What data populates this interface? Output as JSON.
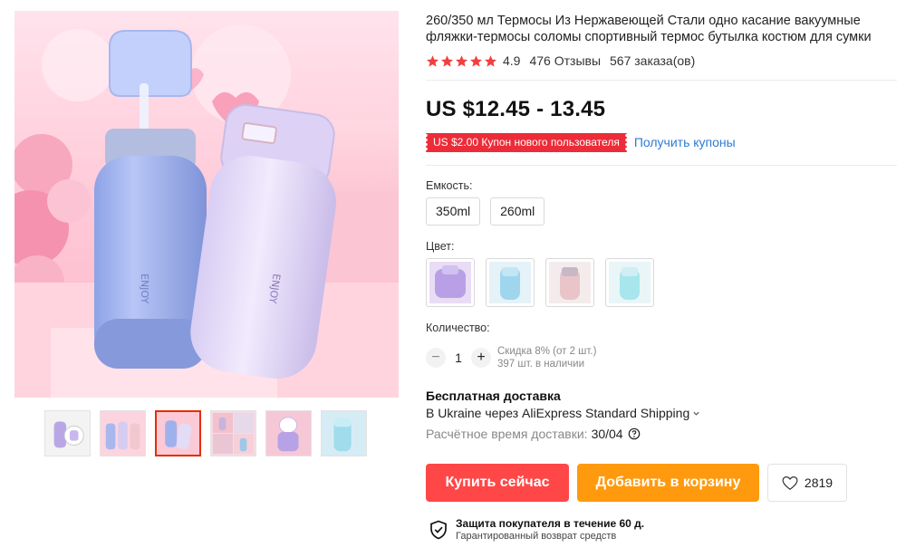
{
  "product": {
    "title": "260/350 мл Термосы Из Нержавеющей Стали одно касание вакуумные фляжки-термосы соломы спортивный термос бутылка костюм для сумки",
    "rating": "4.9",
    "rating_stars": 5,
    "reviews": "476 Отзывы",
    "orders": "567 заказа(ов)",
    "price": "US $12.45 - 13.45",
    "coupon": "US $2.00 Купон нового пользователя",
    "coupon_link": "Получить купоны"
  },
  "gallery": {
    "main_icon": "thermos-bottles-photo",
    "thumbnails": [
      {
        "icon": "thumb-purple-bottle",
        "active": false
      },
      {
        "icon": "thumb-three-bottles",
        "active": false
      },
      {
        "icon": "thumb-blue-bottles",
        "active": true
      },
      {
        "icon": "thumb-collage",
        "active": false
      },
      {
        "icon": "thumb-lid-open",
        "active": false
      },
      {
        "icon": "thumb-turquoise-bottle",
        "active": false
      }
    ]
  },
  "options": {
    "capacity_label": "Емкость:",
    "capacity_values": [
      "350ml",
      "260ml"
    ],
    "color_label": "Цвет:",
    "colors": [
      {
        "icon": "color-purple",
        "accent": "#b9a0e6"
      },
      {
        "icon": "color-blue",
        "accent": "#9fd6ee"
      },
      {
        "icon": "color-pink",
        "accent": "#e9c5c9"
      },
      {
        "icon": "color-cyan",
        "accent": "#a8e6ee"
      }
    ],
    "quantity_label": "Количество:",
    "quantity_value": "1",
    "discount_note": "Скидка 8% (от 2 шт.)",
    "stock_note": "397 шт. в наличии"
  },
  "shipping": {
    "title": "Бесплатная доставка",
    "route": "В Ukraine через AliExpress Standard Shipping",
    "eta_label": "Расчётное время доставки:",
    "eta_value": "30/04"
  },
  "actions": {
    "buy_label": "Купить сейчас",
    "cart_label": "Добавить в корзину",
    "wishlist_count": "2819"
  },
  "protection": {
    "title": "Защита покупателя в течение 60 д.",
    "subtitle": "Гарантированный возврат средств"
  },
  "colors": {
    "buy": "#ff4747",
    "cart": "#ff9a0e",
    "coupon": "#ec2c38",
    "link": "#2e7bd1",
    "star": "#f33f3f"
  }
}
